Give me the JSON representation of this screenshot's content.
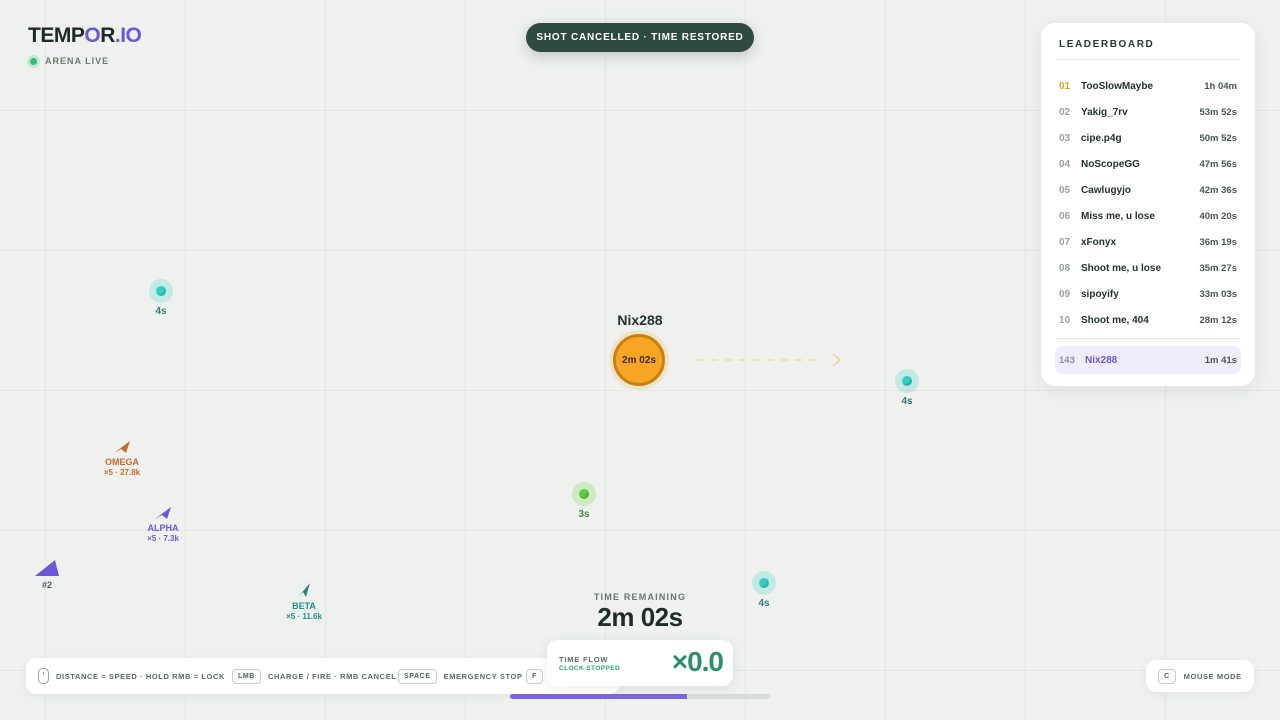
{
  "logo": {
    "pre": "TEMP",
    "mid": "O",
    "post": "R",
    "suffix": ".IO"
  },
  "status": {
    "live_label": "ARENA LIVE",
    "live_color": "#2ac17a"
  },
  "toast": "SHOT CANCELLED · TIME RESTORED",
  "leaderboard": {
    "title": "LEADERBOARD",
    "entries": [
      {
        "rank": "01",
        "name": "TooSlowMaybe",
        "time": "1h 04m"
      },
      {
        "rank": "02",
        "name": "Yakig_7rv",
        "time": "53m 52s"
      },
      {
        "rank": "03",
        "name": "cipe.p4g",
        "time": "50m 52s"
      },
      {
        "rank": "04",
        "name": "NoScopeGG",
        "time": "47m 56s"
      },
      {
        "rank": "05",
        "name": "Cawlugyjo",
        "time": "42m 36s"
      },
      {
        "rank": "06",
        "name": "Miss me, u lose",
        "time": "40m 20s"
      },
      {
        "rank": "07",
        "name": "xFonyx",
        "time": "36m 19s"
      },
      {
        "rank": "08",
        "name": "Shoot me, u lose",
        "time": "35m 27s"
      },
      {
        "rank": "09",
        "name": "sipoyify",
        "time": "33m 03s"
      },
      {
        "rank": "10",
        "name": "Shoot me, 404",
        "time": "28m 12s"
      }
    ],
    "me": {
      "rank": "143",
      "name": "Nix288",
      "time": "1m 41s"
    }
  },
  "player": {
    "name": "Nix288",
    "timer": "2m 02s",
    "color": "#f7a522"
  },
  "pickups": [
    {
      "label": "4s",
      "kind": "cyan"
    },
    {
      "label": "4s",
      "kind": "cyan"
    },
    {
      "label": "3s",
      "kind": "green"
    },
    {
      "label": "4s",
      "kind": "cyan"
    }
  ],
  "enemies": [
    {
      "name": "OMEGA",
      "stats": "×5 · 27.8k",
      "color": "#c8692a"
    },
    {
      "name": "ALPHA",
      "stats": "×5 · 7.3k",
      "color": "#6b57d8"
    },
    {
      "name": "BETA",
      "stats": "×5 · 11.6k",
      "color": "#1f8f86"
    },
    {
      "name": "",
      "stats": "#2",
      "color": "#6b57d8"
    }
  ],
  "time_remaining": {
    "label": "TIME REMAINING",
    "value": "2m 02s"
  },
  "hints": {
    "move": "DISTANCE = SPEED · HOLD RMB = LOCK",
    "lmb_key": "LMB",
    "lmb": "CHARGE / FIRE · RMB CANCEL",
    "space_key": "SPACE",
    "space": "EMERGENCY STOP",
    "f_key": "F"
  },
  "time_flow": {
    "label": "TIME FLOW",
    "sub": "CLOCK STOPPED",
    "value": "×0.0"
  },
  "progress": {
    "fraction": 0.68,
    "color": "#7c63e0"
  },
  "mouse_mode": {
    "key": "C",
    "label": "MOUSE MODE"
  }
}
